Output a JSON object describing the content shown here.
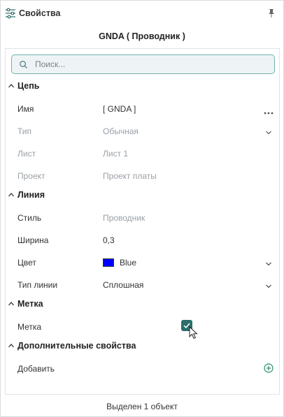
{
  "header": {
    "title": "Свойства"
  },
  "object": {
    "title": "GNDA ( Проводник )"
  },
  "search": {
    "placeholder": "Поиск..."
  },
  "sections": {
    "net": {
      "label": "Цепь"
    },
    "line": {
      "label": "Линия"
    },
    "mark": {
      "label": "Метка"
    },
    "extra": {
      "label": "Дополнительные свойства"
    }
  },
  "net_props": {
    "name": {
      "label": "Имя",
      "value": "[ GNDA ]"
    },
    "type": {
      "label": "Тип",
      "value": "Обычная"
    },
    "sheet": {
      "label": "Лист",
      "value": "Лист 1"
    },
    "project": {
      "label": "Проект",
      "value": "Проект платы"
    }
  },
  "line_props": {
    "style": {
      "label": "Стиль",
      "value": "Проводник"
    },
    "width": {
      "label": "Ширина",
      "value": "0,3"
    },
    "color": {
      "label": "Цвет",
      "value": "Blue",
      "swatch": "#0000ff"
    },
    "line_type": {
      "label": "Тип линии",
      "value": "Сплошная"
    }
  },
  "mark_props": {
    "mark": {
      "label": "Метка",
      "checked": true
    }
  },
  "extra_props": {
    "add": {
      "label": "Добавить"
    }
  },
  "footer": {
    "status": "Выделен 1 объект"
  },
  "colors": {
    "accent": "#2a6e68",
    "search_border": "#6fb3aa",
    "swatch_blue": "#0000ff"
  }
}
